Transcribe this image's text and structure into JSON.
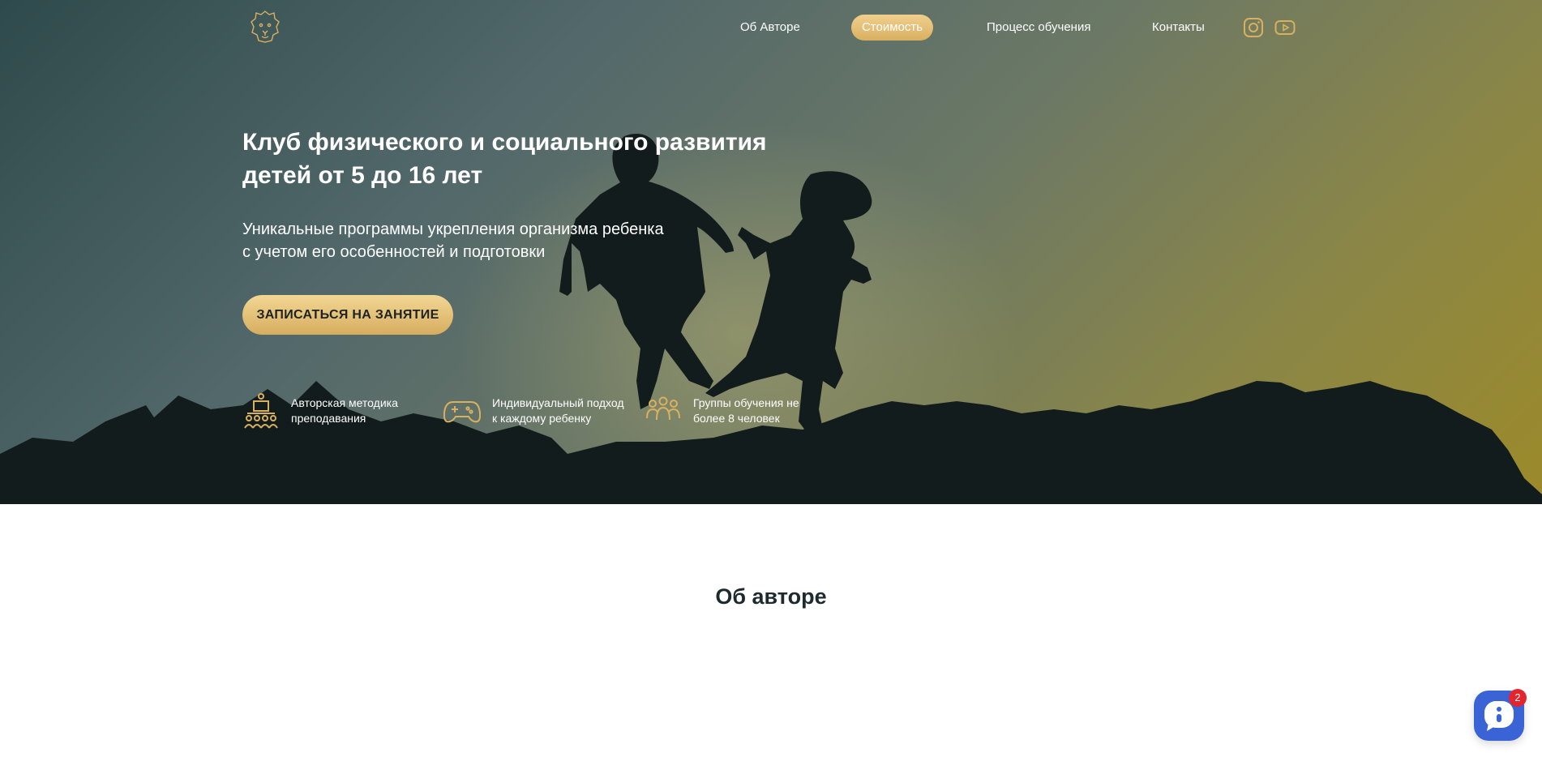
{
  "nav": {
    "items": [
      {
        "label": "Об Авторе"
      },
      {
        "label": "Стоимость",
        "active": true
      },
      {
        "label": "Процесс обучения"
      },
      {
        "label": "Контакты"
      }
    ],
    "social": [
      "instagram-icon",
      "youtube-icon"
    ]
  },
  "hero": {
    "title": "Клуб физического и социального развития детей от 5 до 16 лет",
    "subtitle_line1": "Уникальные программы укрепления организма ребенка",
    "subtitle_line2": "с учетом его особенностей и подготовки",
    "cta": "ЗАПИСАТЬСЯ НА ЗАНЯТИЕ",
    "features": [
      {
        "icon": "teaching-method-icon",
        "line1": "Авторская методика",
        "line2": "преподавания"
      },
      {
        "icon": "gamepad-icon",
        "line1": "Индивидуальный подход",
        "line2": "к каждому ребенку"
      },
      {
        "icon": "group-icon",
        "line1": "Группы обучения не",
        "line2": "более 8 человек"
      }
    ]
  },
  "about": {
    "title": "Об авторе"
  },
  "chat": {
    "badge": "2"
  },
  "colors": {
    "accent": "#d9b060",
    "dark": "#1e2a2e",
    "chat": "#3a63d6",
    "badge": "#e5242b"
  }
}
